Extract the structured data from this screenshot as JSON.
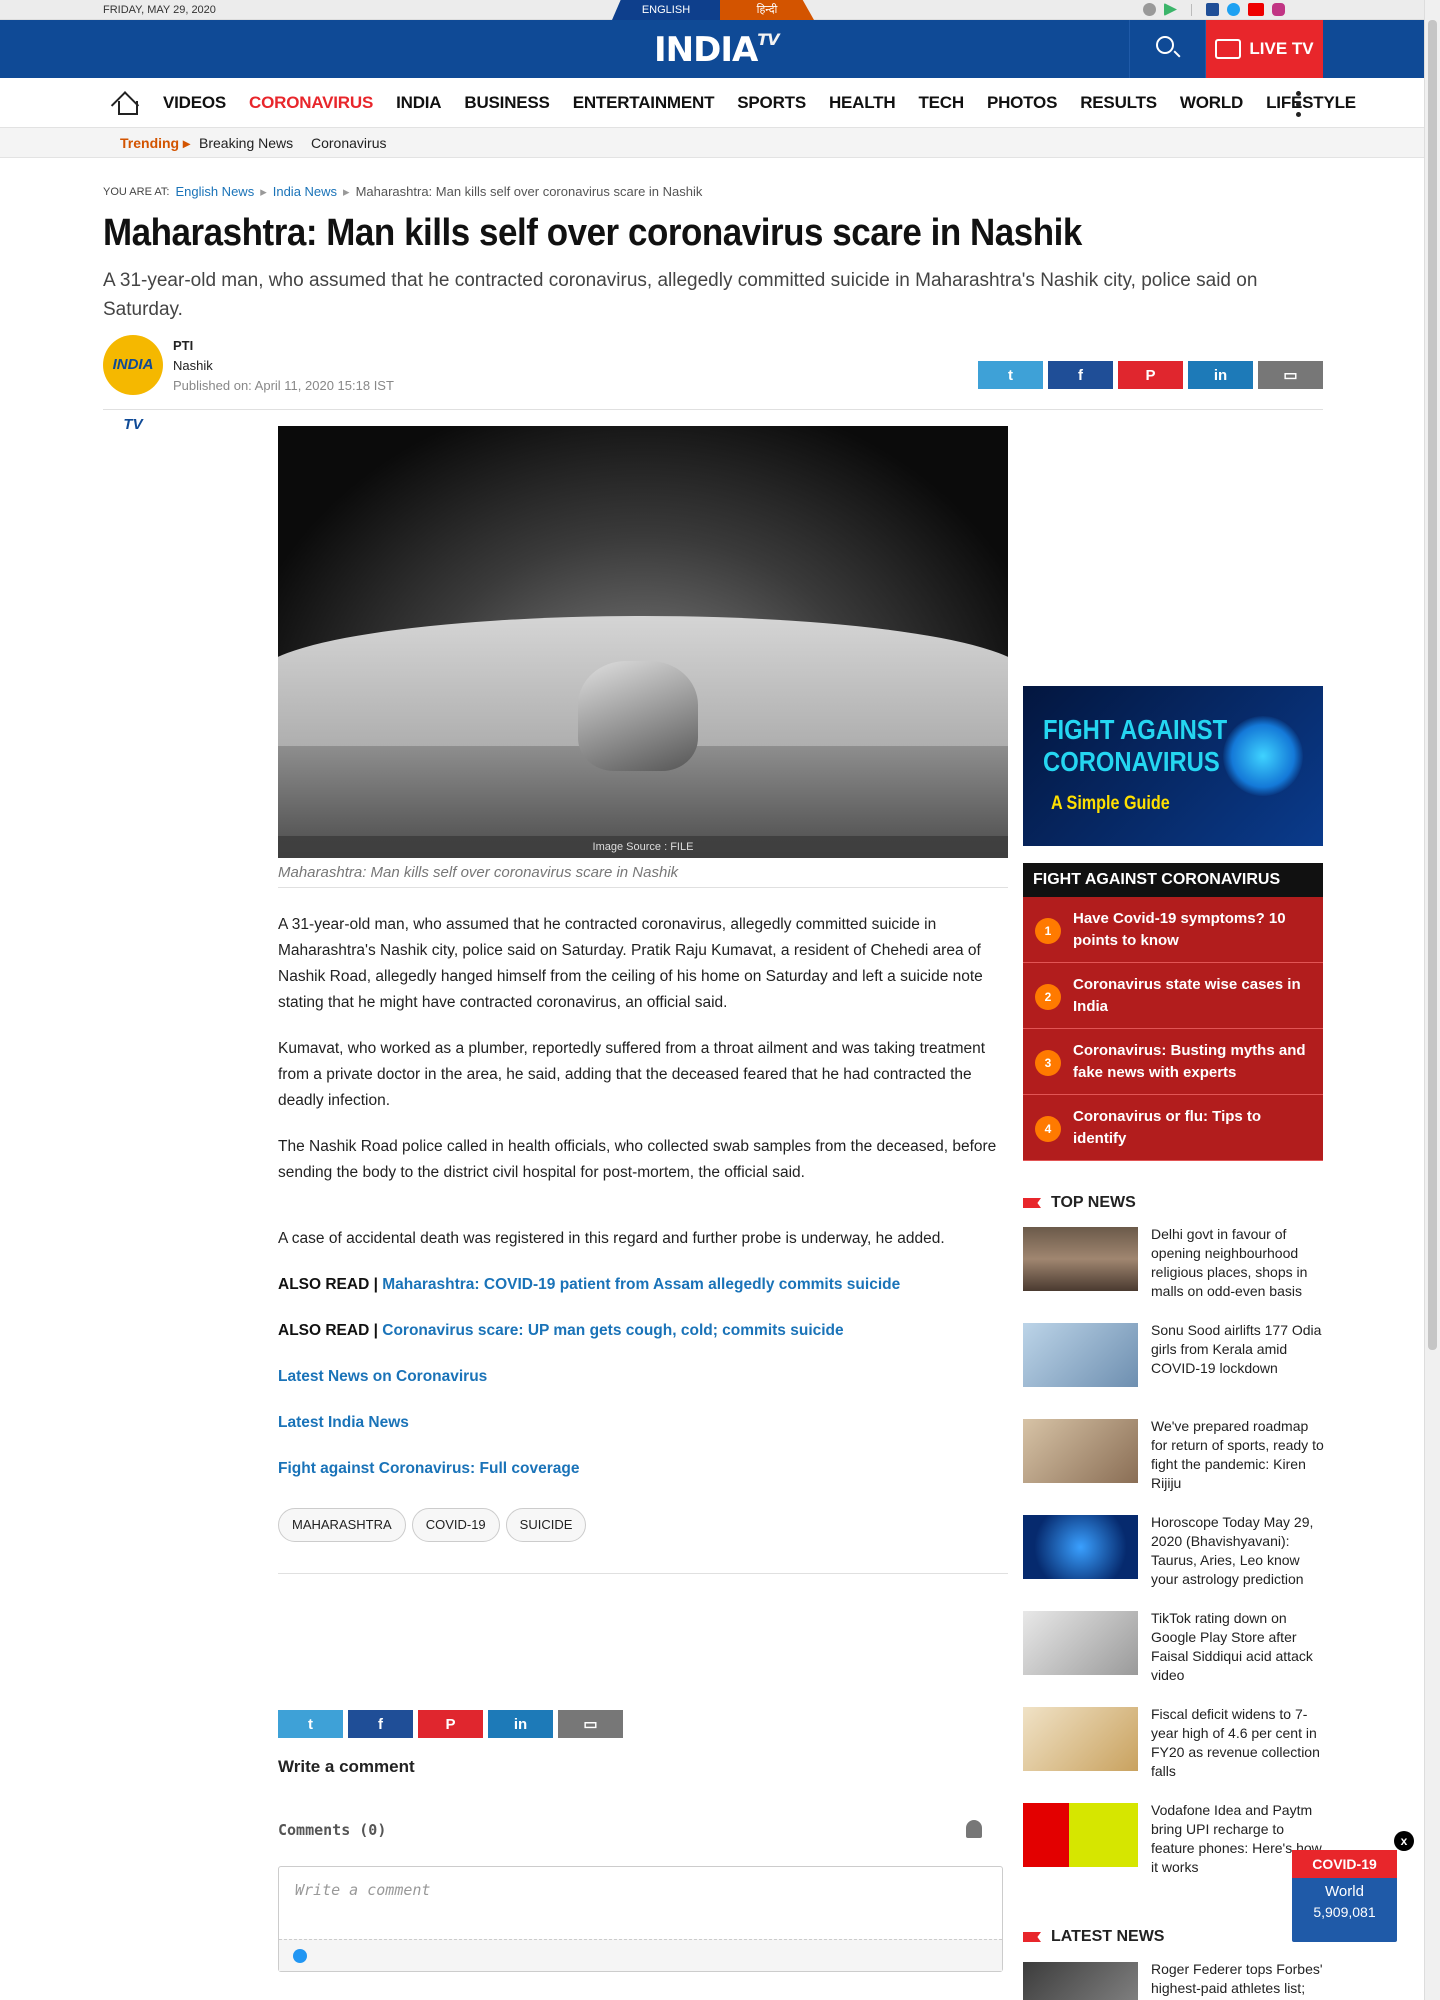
{
  "topbar": {
    "date": "FRIDAY, MAY 29, 2020",
    "lang_en": "ENGLISH",
    "lang_hi": "हिन्दी"
  },
  "header": {
    "logo": "INDIA",
    "logo_tv": "TV",
    "live_tv": "LIVE TV"
  },
  "nav": {
    "items": [
      "VIDEOS",
      "CORONAVIRUS",
      "INDIA",
      "BUSINESS",
      "ENTERTAINMENT",
      "SPORTS",
      "HEALTH",
      "TECH",
      "PHOTOS",
      "RESULTS",
      "WORLD",
      "LIFESTYLE"
    ]
  },
  "trending": {
    "label": "Trending",
    "items": [
      "Breaking News",
      "Coronavirus"
    ]
  },
  "breadcrumb": {
    "prefix": "YOU ARE AT:",
    "items": [
      "English News",
      "India News"
    ],
    "current": "Maharashtra: Man kills self over coronavirus scare in Nashik"
  },
  "article": {
    "title": "Maharashtra: Man kills self over coronavirus scare in Nashik",
    "summary": "A 31-year-old man, who assumed that he contracted coronavirus, allegedly committed suicide in Maharashtra's Nashik city, police said on Saturday.",
    "author": "PTI",
    "place": "Nashik",
    "published": "Published on: April 11, 2020 15:18 IST",
    "avatar_text": "INDIA TV",
    "image_source": "Image Source : FILE",
    "caption": "Maharashtra: Man kills self over coronavirus scare in Nashik",
    "paragraphs": [
      "A 31-year-old man, who assumed that he contracted coronavirus, allegedly committed suicide in Maharashtra's Nashik city, police said on Saturday.  Pratik Raju Kumavat, a resident of Chehedi area of Nashik Road, allegedly hanged himself from the ceiling of his home on Saturday and left a suicide note stating that he might have contracted coronavirus, an official said.",
      "Kumavat, who worked as a plumber, reportedly suffered from a throat ailment and was taking treatment from a private doctor in the area, he said, adding that the deceased feared that he had contracted the deadly infection.",
      "The Nashik Road police called in health officials, who collected swab samples from the deceased, before sending the body to the district civil hospital for post-mortem, the official said.",
      "A case of accidental death was registered in this regard and further probe is underway, he added."
    ],
    "also_read_label": "ALSO READ |",
    "also_read": [
      "Maharashtra: COVID-19 patient from Assam allegedly commits suicide",
      "Coronavirus scare: UP man gets cough, cold; commits suicide"
    ],
    "links": [
      "Latest News on Coronavirus",
      "Latest India News",
      "Fight against Coronavirus: Full coverage"
    ],
    "tags": [
      "MAHARASHTRA",
      "COVID-19",
      "SUICIDE"
    ]
  },
  "comments": {
    "write_label": "Write a comment",
    "count_label": "Comments (0)",
    "placeholder": "Write a comment"
  },
  "sidebar": {
    "promo_line1": "FIGHT AGAINST",
    "promo_line2": "CORONAVIRUS",
    "promo_sub": "A Simple Guide",
    "fac_title": "FIGHT AGAINST CORONAVIRUS",
    "fac_items": [
      {
        "n": "1",
        "text": "Have Covid-19 symptoms? 10 points to know"
      },
      {
        "n": "2",
        "text": "Coronavirus state wise cases in India"
      },
      {
        "n": "3",
        "text": "Coronavirus: Busting myths and fake news with experts"
      },
      {
        "n": "4",
        "text": "Coronavirus or flu: Tips to identify"
      }
    ],
    "top_news_title": "TOP NEWS",
    "top_news": [
      "Delhi govt in favour of opening neighbourhood religious places, shops in malls on odd-even basis",
      "Sonu Sood airlifts 177 Odia girls from Kerala amid COVID-19 lockdown",
      "We've prepared roadmap for return of sports, ready to fight the pandemic: Kiren Rijiju",
      "Horoscope Today May 29, 2020 (Bhavishyavani): Taurus, Aries, Leo know your astrology prediction",
      "TikTok rating down on Google Play Store after Faisal Siddiqui acid attack video",
      "Fiscal deficit widens to 7-year high of 4.6 per cent in FY20 as revenue collection falls",
      "Vodafone Idea and Paytm bring UPI recharge to feature phones: Here's how it works"
    ],
    "latest_news_title": "LATEST NEWS",
    "latest_news": [
      "Roger Federer tops Forbes' highest-paid athletes list;"
    ]
  },
  "covid_widget": {
    "title": "COVID-19",
    "region": "World",
    "count": "5,909,081",
    "close": "x"
  },
  "colors": {
    "brand_blue": "#0f4a96",
    "accent_red": "#e8262b",
    "link_blue": "#1a73b8"
  }
}
